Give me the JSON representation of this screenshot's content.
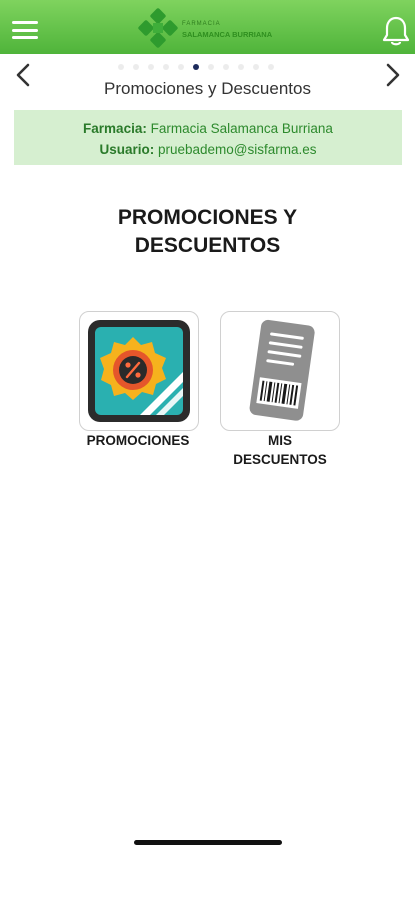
{
  "header": {
    "menu_icon": "hamburger-menu-icon",
    "logo_top_text": "FARMACIA",
    "logo_main_text": "SALAMANCA BURRIANA",
    "bell_icon": "bell-icon",
    "brand_color": "#4fb43a"
  },
  "carousel": {
    "prev_icon": "chevron-left-icon",
    "next_icon": "chevron-right-icon",
    "dot_count": 11,
    "active_dot": 5,
    "title": "Promociones y Descuentos"
  },
  "info": {
    "farmacia_label": "Farmacia:",
    "farmacia_value": "Farmacia Salamanca Burriana",
    "usuario_label": "Usuario:",
    "usuario_value": "pruebademo@sisfarma.es"
  },
  "main": {
    "title_line1": "PROMOCIONES Y",
    "title_line2": "DESCUENTOS"
  },
  "options": {
    "promociones": {
      "label": "PROMOCIONES",
      "icon": "percent-badge-icon"
    },
    "descuentos": {
      "label_line1": "MIS",
      "label_line2": "DESCUENTOS",
      "icon": "barcode-card-icon"
    }
  }
}
